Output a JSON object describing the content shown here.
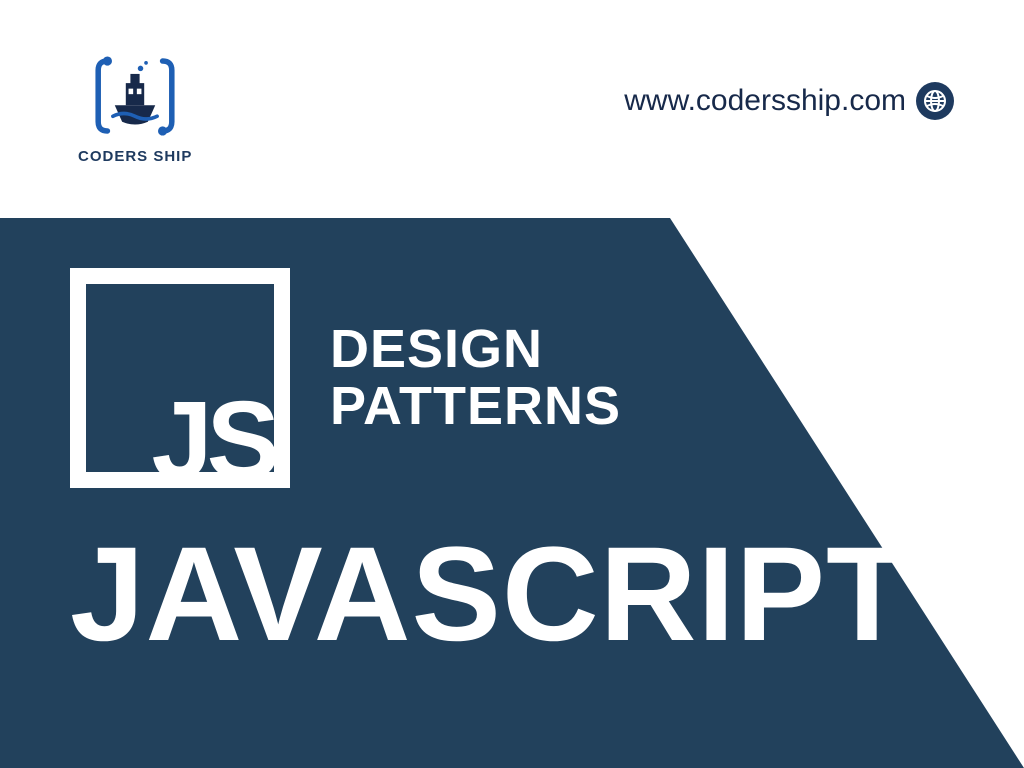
{
  "brand": {
    "name": "CODERS SHIP",
    "url": "www.codersship.com"
  },
  "hero": {
    "badge": "JS",
    "subtitle_line1": "DESIGN",
    "subtitle_line2": "PATTERNS",
    "title": "JAVASCRIPT"
  },
  "colors": {
    "dark": "#22415c",
    "brand": "#1e3a5f"
  }
}
